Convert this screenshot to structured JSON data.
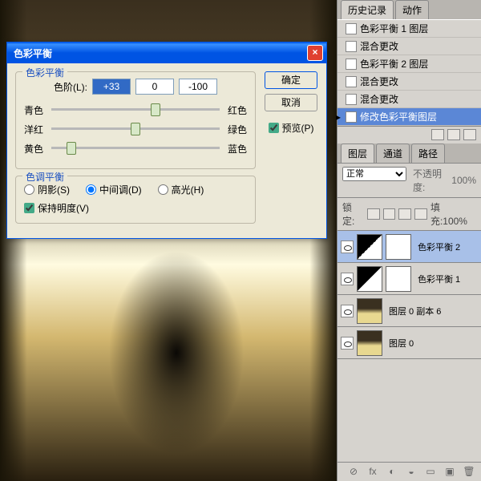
{
  "dialog": {
    "title": "色彩平衡",
    "section1": {
      "legend": "色彩平衡",
      "level_label": "色阶(L):",
      "values": [
        "+33",
        "0",
        "-100"
      ],
      "sliders": [
        {
          "left": "青色",
          "right": "红色",
          "pos": 62
        },
        {
          "left": "洋红",
          "right": "绿色",
          "pos": 50
        },
        {
          "left": "黄色",
          "right": "蓝色",
          "pos": 12
        }
      ]
    },
    "section2": {
      "legend": "色调平衡",
      "options": [
        "阴影(S)",
        "中间调(D)",
        "高光(H)"
      ],
      "preserve": "保持明度(V)"
    },
    "buttons": {
      "ok": "确定",
      "cancel": "取消"
    },
    "preview": "预览(P)"
  },
  "history": {
    "tabs": [
      "历史记录",
      "动作"
    ],
    "items": [
      "色彩平衡 1 图层",
      "混合更改",
      "色彩平衡 2 图层",
      "混合更改",
      "混合更改",
      "修改色彩平衡图层"
    ]
  },
  "layers": {
    "tabs": [
      "图层",
      "通道",
      "路径"
    ],
    "blend": "正常",
    "opacity_label": "不透明度:",
    "opacity": "100%",
    "lock_label": "锁定:",
    "fill_label": "填充:",
    "fill": "100%",
    "items": [
      {
        "name": "色彩平衡 2",
        "type": "adj"
      },
      {
        "name": "色彩平衡 1",
        "type": "adj"
      },
      {
        "name": "图层 0 副本 6",
        "type": "img"
      },
      {
        "name": "图层 0",
        "type": "img"
      }
    ]
  },
  "chart_data": {
    "type": "table",
    "title": "色彩平衡调整值",
    "series": [
      {
        "name": "青色-红色",
        "values": [
          33
        ]
      },
      {
        "name": "洋红-绿色",
        "values": [
          0
        ]
      },
      {
        "name": "黄色-蓝色",
        "values": [
          -100
        ]
      }
    ],
    "range": [
      -100,
      100
    ]
  }
}
